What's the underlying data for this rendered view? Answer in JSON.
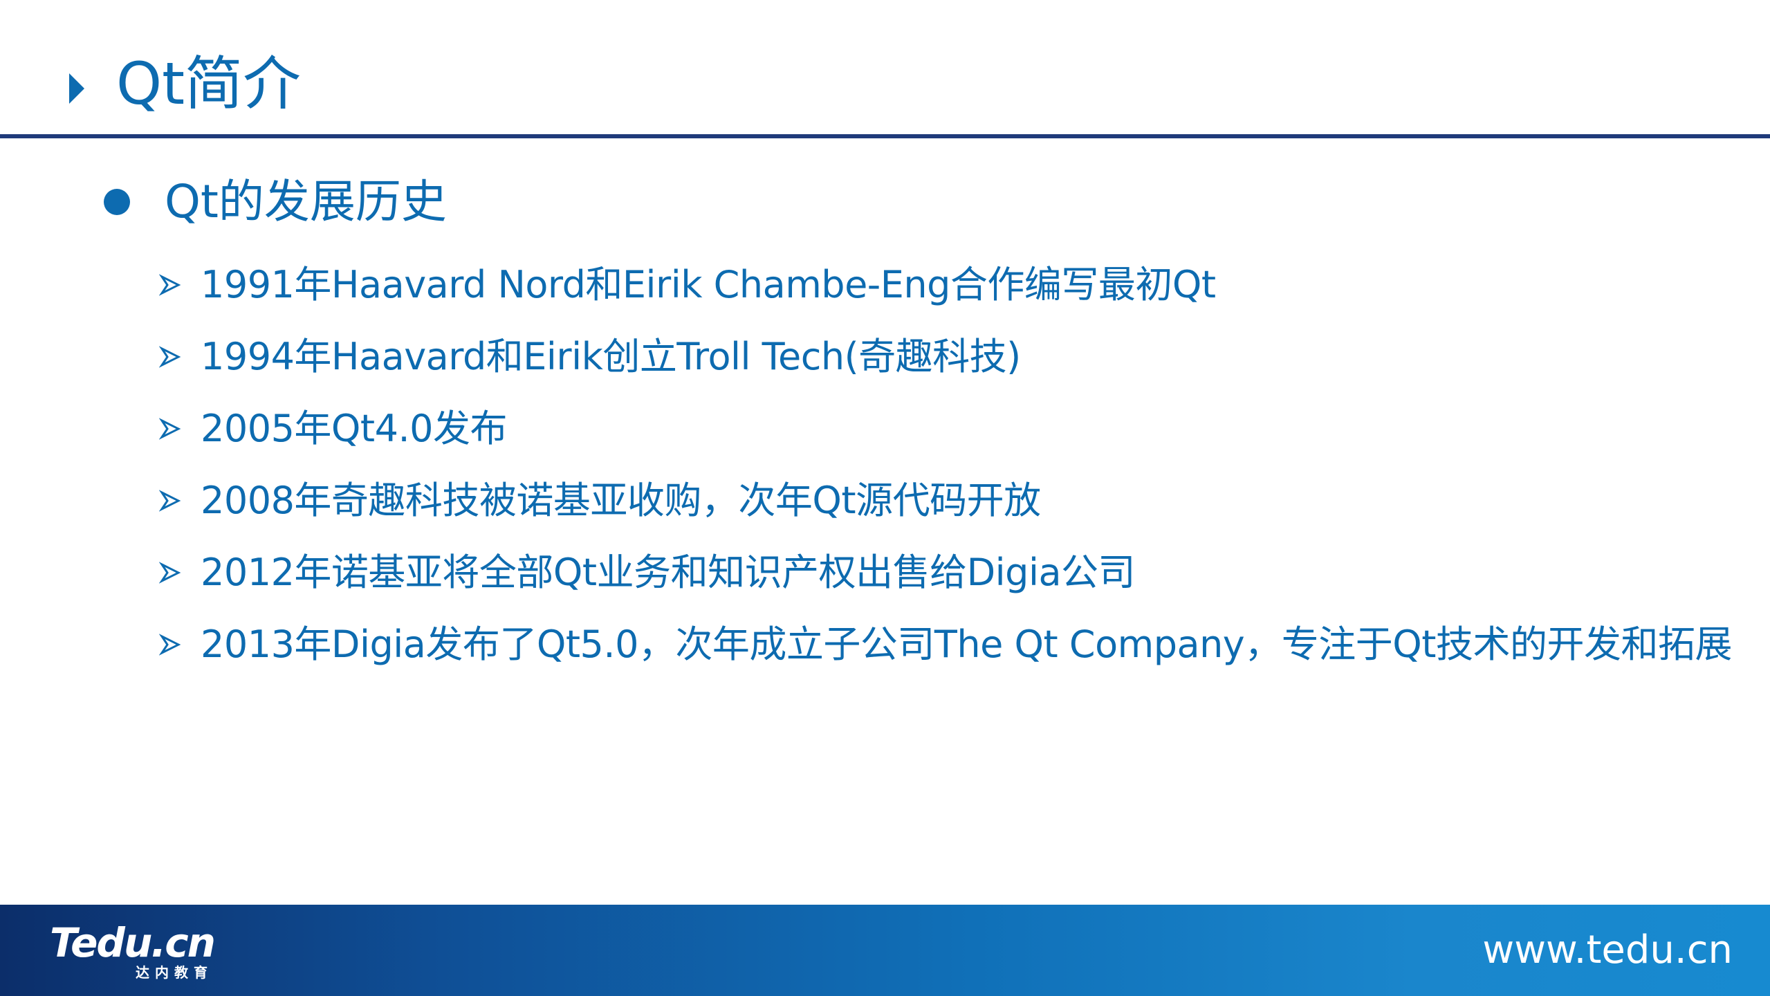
{
  "title": "Qt简介",
  "section": {
    "heading": "Qt的发展历史"
  },
  "items": [
    {
      "text": "1991年Haavard Nord和Eirik Chambe-Eng合作编写最初Qt"
    },
    {
      "text": "1994年Haavard和Eirik创立Troll Tech(奇趣科技)"
    },
    {
      "text": "2005年Qt4.0发布"
    },
    {
      "text": "2008年奇趣科技被诺基亚收购，次年Qt源代码开放"
    },
    {
      "text": "2012年诺基亚将全部Qt业务和知识产权出售给Digia公司"
    },
    {
      "text": "2013年Digia发布了Qt5.0，次年成立子公司The Qt Company，专注于Qt技术的开发和拓展"
    }
  ],
  "footer": {
    "logo_main": "Tedu.cn",
    "logo_sub": "达内教育",
    "url": "www.tedu.cn"
  },
  "colors": {
    "accent": "#0d6bb0",
    "rule": "#1f3a7a",
    "footer_start": "#0c2e6a",
    "footer_end": "#178ad0"
  },
  "icons": {
    "title_marker": "triangle-right-icon",
    "section_marker": "filled-circle-icon",
    "item_marker": "arrowhead-bullet-icon"
  }
}
